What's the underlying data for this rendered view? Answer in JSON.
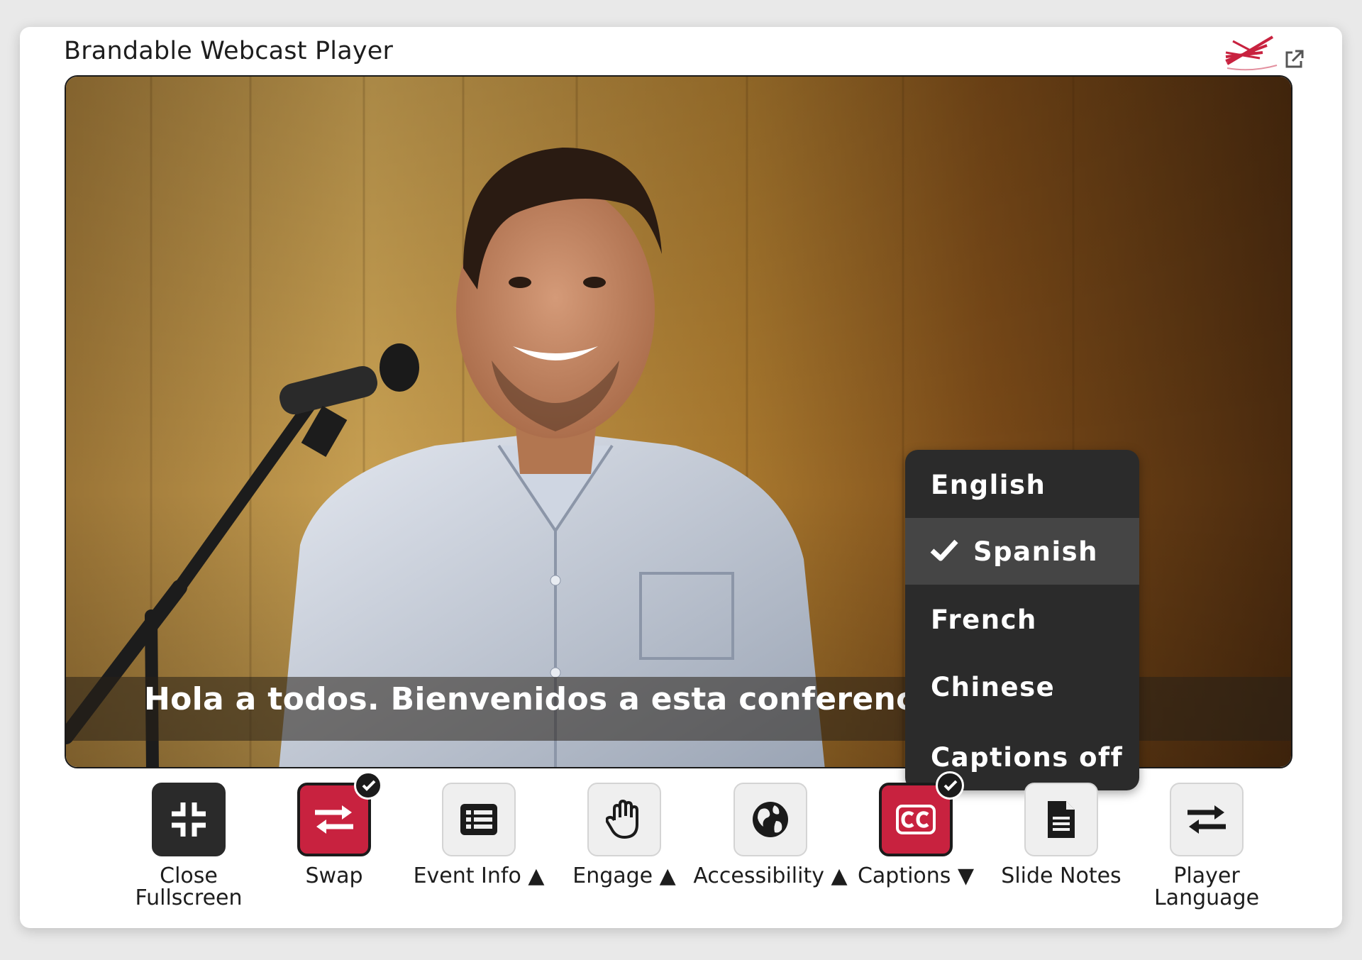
{
  "window": {
    "title": "Brandable Webcast Player"
  },
  "icons": {
    "brand": "brand-logo-icon",
    "popout": "popout-icon"
  },
  "video": {
    "caption": "Hola a todos. Bienvenidos a esta conferencia"
  },
  "captions_menu": {
    "items": [
      {
        "label": "English",
        "selected": false
      },
      {
        "label": "Spanish",
        "selected": true
      },
      {
        "label": "French",
        "selected": false
      },
      {
        "label": "Chinese",
        "selected": false
      },
      {
        "label": "Captions off",
        "selected": false
      }
    ]
  },
  "controls": [
    {
      "label_line1": "Close",
      "label_line2": "Fullscreen",
      "icon": "compress-icon",
      "state": "dark"
    },
    {
      "label_line1": "Swap",
      "label_line2": "",
      "icon": "swap-arrows-icon",
      "state": "active",
      "checked": true
    },
    {
      "label_line1": "Event Info ▲",
      "label_line2": "",
      "icon": "list-icon",
      "state": "default"
    },
    {
      "label_line1": "Engage ▲",
      "label_line2": "",
      "icon": "raised-hand-icon",
      "state": "default"
    },
    {
      "label_line1": "Accessibility ▲",
      "label_line2": "",
      "icon": "globe-icon",
      "state": "default"
    },
    {
      "label_line1": "Captions ▼",
      "label_line2": "",
      "icon": "cc-icon",
      "state": "active",
      "checked": true
    },
    {
      "label_line1": "Slide Notes",
      "label_line2": "",
      "icon": "document-icon",
      "state": "default"
    },
    {
      "label_line1": "Player",
      "label_line2": "Language",
      "icon": "exchange-icon",
      "state": "default"
    }
  ],
  "colors": {
    "accent": "#c8223f",
    "dark_button": "#2a2a2a",
    "menu_bg": "#2b2b2b",
    "menu_selected": "#454545"
  }
}
